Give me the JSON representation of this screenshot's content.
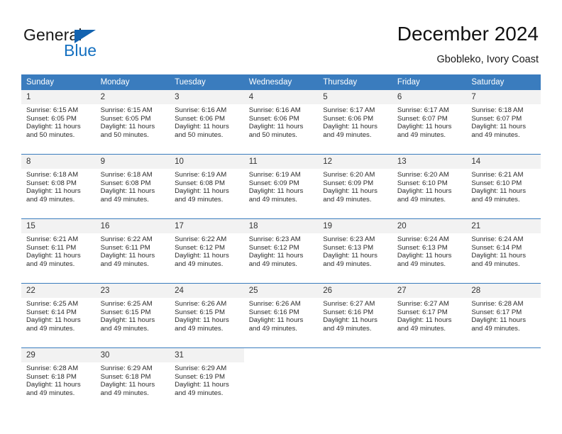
{
  "brand": {
    "name_dark": "General",
    "name_blue": "Blue",
    "triangle_color": "#1363b0",
    "blue_color": "#1570c0"
  },
  "header": {
    "title": "December 2024",
    "subtitle": "Gbobleko, Ivory Coast"
  },
  "theme": {
    "header_blue": "#3a7cbe",
    "daynum_bg": "#f2f2f2",
    "text": "#2b2b2b"
  },
  "calendar": {
    "weekday_headers": [
      "Sunday",
      "Monday",
      "Tuesday",
      "Wednesday",
      "Thursday",
      "Friday",
      "Saturday"
    ],
    "labels": {
      "sunrise_prefix": "Sunrise:",
      "sunset_prefix": "Sunset:",
      "daylight_prefix": "Daylight:"
    },
    "weeks": [
      [
        {
          "day": "1",
          "sunrise": "Sunrise: 6:15 AM",
          "sunset": "Sunset: 6:05 PM",
          "daylight_line1": "Daylight: 11 hours",
          "daylight_line2": "and 50 minutes."
        },
        {
          "day": "2",
          "sunrise": "Sunrise: 6:15 AM",
          "sunset": "Sunset: 6:05 PM",
          "daylight_line1": "Daylight: 11 hours",
          "daylight_line2": "and 50 minutes."
        },
        {
          "day": "3",
          "sunrise": "Sunrise: 6:16 AM",
          "sunset": "Sunset: 6:06 PM",
          "daylight_line1": "Daylight: 11 hours",
          "daylight_line2": "and 50 minutes."
        },
        {
          "day": "4",
          "sunrise": "Sunrise: 6:16 AM",
          "sunset": "Sunset: 6:06 PM",
          "daylight_line1": "Daylight: 11 hours",
          "daylight_line2": "and 50 minutes."
        },
        {
          "day": "5",
          "sunrise": "Sunrise: 6:17 AM",
          "sunset": "Sunset: 6:06 PM",
          "daylight_line1": "Daylight: 11 hours",
          "daylight_line2": "and 49 minutes."
        },
        {
          "day": "6",
          "sunrise": "Sunrise: 6:17 AM",
          "sunset": "Sunset: 6:07 PM",
          "daylight_line1": "Daylight: 11 hours",
          "daylight_line2": "and 49 minutes."
        },
        {
          "day": "7",
          "sunrise": "Sunrise: 6:18 AM",
          "sunset": "Sunset: 6:07 PM",
          "daylight_line1": "Daylight: 11 hours",
          "daylight_line2": "and 49 minutes."
        }
      ],
      [
        {
          "day": "8",
          "sunrise": "Sunrise: 6:18 AM",
          "sunset": "Sunset: 6:08 PM",
          "daylight_line1": "Daylight: 11 hours",
          "daylight_line2": "and 49 minutes."
        },
        {
          "day": "9",
          "sunrise": "Sunrise: 6:18 AM",
          "sunset": "Sunset: 6:08 PM",
          "daylight_line1": "Daylight: 11 hours",
          "daylight_line2": "and 49 minutes."
        },
        {
          "day": "10",
          "sunrise": "Sunrise: 6:19 AM",
          "sunset": "Sunset: 6:08 PM",
          "daylight_line1": "Daylight: 11 hours",
          "daylight_line2": "and 49 minutes."
        },
        {
          "day": "11",
          "sunrise": "Sunrise: 6:19 AM",
          "sunset": "Sunset: 6:09 PM",
          "daylight_line1": "Daylight: 11 hours",
          "daylight_line2": "and 49 minutes."
        },
        {
          "day": "12",
          "sunrise": "Sunrise: 6:20 AM",
          "sunset": "Sunset: 6:09 PM",
          "daylight_line1": "Daylight: 11 hours",
          "daylight_line2": "and 49 minutes."
        },
        {
          "day": "13",
          "sunrise": "Sunrise: 6:20 AM",
          "sunset": "Sunset: 6:10 PM",
          "daylight_line1": "Daylight: 11 hours",
          "daylight_line2": "and 49 minutes."
        },
        {
          "day": "14",
          "sunrise": "Sunrise: 6:21 AM",
          "sunset": "Sunset: 6:10 PM",
          "daylight_line1": "Daylight: 11 hours",
          "daylight_line2": "and 49 minutes."
        }
      ],
      [
        {
          "day": "15",
          "sunrise": "Sunrise: 6:21 AM",
          "sunset": "Sunset: 6:11 PM",
          "daylight_line1": "Daylight: 11 hours",
          "daylight_line2": "and 49 minutes."
        },
        {
          "day": "16",
          "sunrise": "Sunrise: 6:22 AM",
          "sunset": "Sunset: 6:11 PM",
          "daylight_line1": "Daylight: 11 hours",
          "daylight_line2": "and 49 minutes."
        },
        {
          "day": "17",
          "sunrise": "Sunrise: 6:22 AM",
          "sunset": "Sunset: 6:12 PM",
          "daylight_line1": "Daylight: 11 hours",
          "daylight_line2": "and 49 minutes."
        },
        {
          "day": "18",
          "sunrise": "Sunrise: 6:23 AM",
          "sunset": "Sunset: 6:12 PM",
          "daylight_line1": "Daylight: 11 hours",
          "daylight_line2": "and 49 minutes."
        },
        {
          "day": "19",
          "sunrise": "Sunrise: 6:23 AM",
          "sunset": "Sunset: 6:13 PM",
          "daylight_line1": "Daylight: 11 hours",
          "daylight_line2": "and 49 minutes."
        },
        {
          "day": "20",
          "sunrise": "Sunrise: 6:24 AM",
          "sunset": "Sunset: 6:13 PM",
          "daylight_line1": "Daylight: 11 hours",
          "daylight_line2": "and 49 minutes."
        },
        {
          "day": "21",
          "sunrise": "Sunrise: 6:24 AM",
          "sunset": "Sunset: 6:14 PM",
          "daylight_line1": "Daylight: 11 hours",
          "daylight_line2": "and 49 minutes."
        }
      ],
      [
        {
          "day": "22",
          "sunrise": "Sunrise: 6:25 AM",
          "sunset": "Sunset: 6:14 PM",
          "daylight_line1": "Daylight: 11 hours",
          "daylight_line2": "and 49 minutes."
        },
        {
          "day": "23",
          "sunrise": "Sunrise: 6:25 AM",
          "sunset": "Sunset: 6:15 PM",
          "daylight_line1": "Daylight: 11 hours",
          "daylight_line2": "and 49 minutes."
        },
        {
          "day": "24",
          "sunrise": "Sunrise: 6:26 AM",
          "sunset": "Sunset: 6:15 PM",
          "daylight_line1": "Daylight: 11 hours",
          "daylight_line2": "and 49 minutes."
        },
        {
          "day": "25",
          "sunrise": "Sunrise: 6:26 AM",
          "sunset": "Sunset: 6:16 PM",
          "daylight_line1": "Daylight: 11 hours",
          "daylight_line2": "and 49 minutes."
        },
        {
          "day": "26",
          "sunrise": "Sunrise: 6:27 AM",
          "sunset": "Sunset: 6:16 PM",
          "daylight_line1": "Daylight: 11 hours",
          "daylight_line2": "and 49 minutes."
        },
        {
          "day": "27",
          "sunrise": "Sunrise: 6:27 AM",
          "sunset": "Sunset: 6:17 PM",
          "daylight_line1": "Daylight: 11 hours",
          "daylight_line2": "and 49 minutes."
        },
        {
          "day": "28",
          "sunrise": "Sunrise: 6:28 AM",
          "sunset": "Sunset: 6:17 PM",
          "daylight_line1": "Daylight: 11 hours",
          "daylight_line2": "and 49 minutes."
        }
      ],
      [
        {
          "day": "29",
          "sunrise": "Sunrise: 6:28 AM",
          "sunset": "Sunset: 6:18 PM",
          "daylight_line1": "Daylight: 11 hours",
          "daylight_line2": "and 49 minutes."
        },
        {
          "day": "30",
          "sunrise": "Sunrise: 6:29 AM",
          "sunset": "Sunset: 6:18 PM",
          "daylight_line1": "Daylight: 11 hours",
          "daylight_line2": "and 49 minutes."
        },
        {
          "day": "31",
          "sunrise": "Sunrise: 6:29 AM",
          "sunset": "Sunset: 6:19 PM",
          "daylight_line1": "Daylight: 11 hours",
          "daylight_line2": "and 49 minutes."
        },
        {
          "day": "",
          "sunrise": "",
          "sunset": "",
          "daylight_line1": "",
          "daylight_line2": ""
        },
        {
          "day": "",
          "sunrise": "",
          "sunset": "",
          "daylight_line1": "",
          "daylight_line2": ""
        },
        {
          "day": "",
          "sunrise": "",
          "sunset": "",
          "daylight_line1": "",
          "daylight_line2": ""
        },
        {
          "day": "",
          "sunrise": "",
          "sunset": "",
          "daylight_line1": "",
          "daylight_line2": ""
        }
      ]
    ]
  }
}
